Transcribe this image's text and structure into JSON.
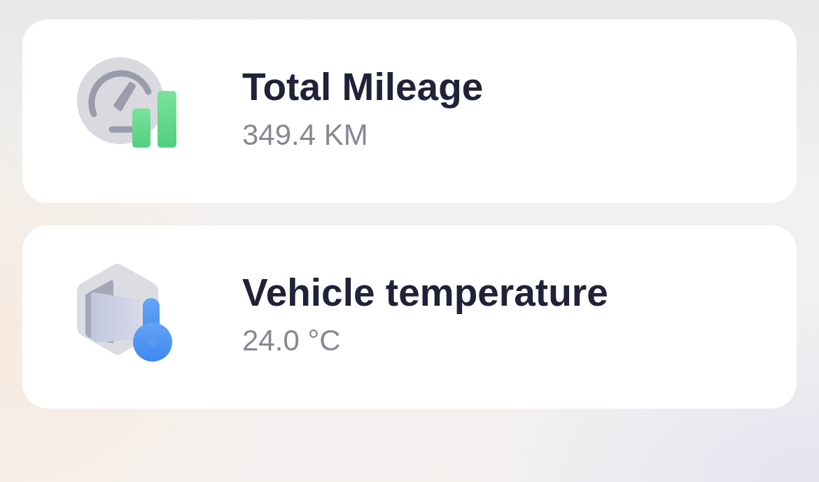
{
  "cards": [
    {
      "kind": "mileage",
      "title": "Total Mileage",
      "value": "349.4 KM"
    },
    {
      "kind": "temperature",
      "title": "Vehicle temperature",
      "value": "24.0 °C"
    }
  ]
}
